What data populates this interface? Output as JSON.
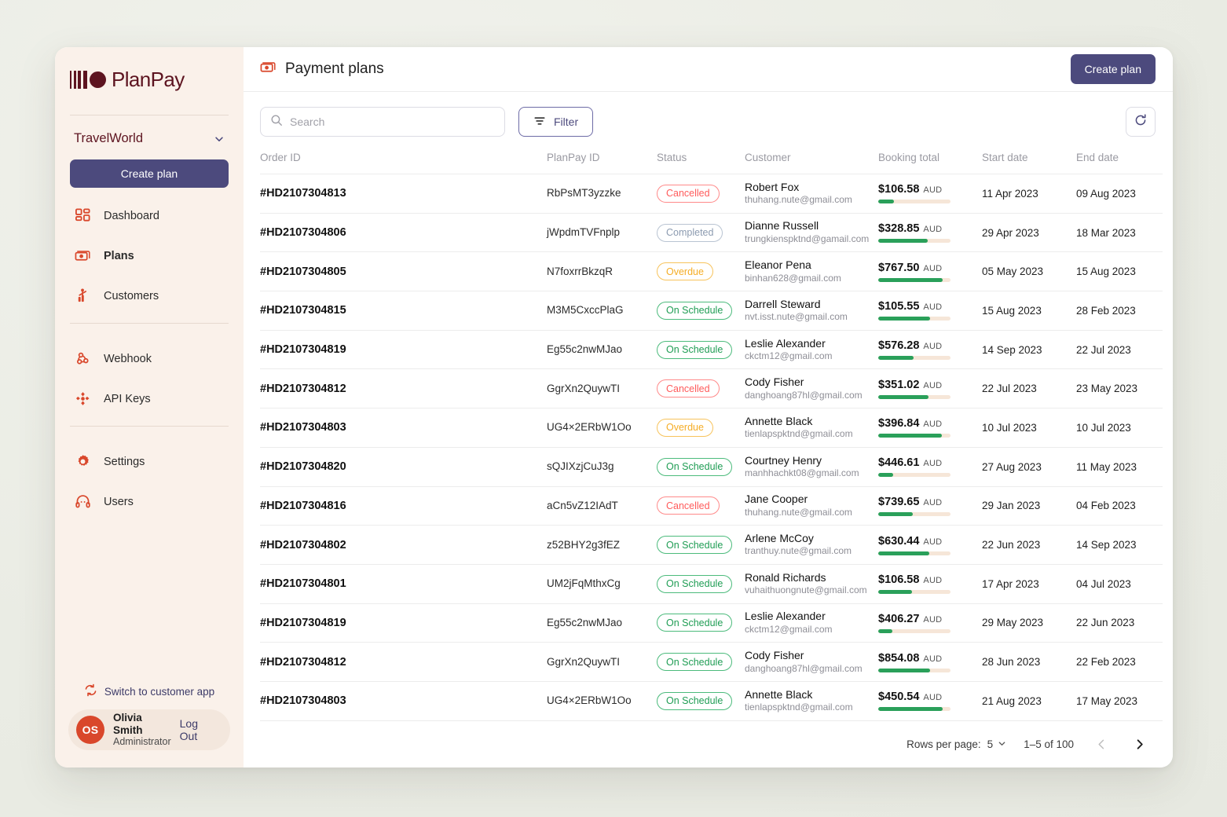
{
  "sidebar": {
    "logo_text": "PlanPay",
    "org_name": "TravelWorld",
    "create_plan_label": "Create plan",
    "nav_top": [
      {
        "label": "Dashboard",
        "icon": "grid-icon",
        "active": false
      },
      {
        "label": "Plans",
        "icon": "money-icon",
        "active": true
      },
      {
        "label": "Customers",
        "icon": "customers-icon",
        "active": false
      }
    ],
    "nav_mid": [
      {
        "label": "Webhook",
        "icon": "webhook-icon",
        "active": false
      },
      {
        "label": "API Keys",
        "icon": "api-keys-icon",
        "active": false
      }
    ],
    "nav_bottom": [
      {
        "label": "Settings",
        "icon": "gear-icon",
        "active": false
      },
      {
        "label": "Users",
        "icon": "headset-icon",
        "active": false
      }
    ],
    "switch_label": "Switch to customer app",
    "user": {
      "initials": "OS",
      "name": "Olivia Smith",
      "role": "Administrator",
      "logout_label": "Log Out"
    }
  },
  "header": {
    "title": "Payment plans",
    "title_icon": "money-icon",
    "create_plan_label": "Create plan"
  },
  "toolbar": {
    "search_placeholder": "Search",
    "search_value": "",
    "filter_label": "Filter",
    "refresh_icon": "refresh-icon"
  },
  "table": {
    "columns": [
      "Order ID",
      "PlanPay ID",
      "Status",
      "Customer",
      "Booking total",
      "Start date",
      "End date"
    ],
    "rows": [
      {
        "order_id": "#HD2107304813",
        "planpay_id": "RbPsMT3yzzke",
        "status": "Cancelled",
        "customer": "Robert Fox",
        "email": "thuhang.nute@gmail.com",
        "amount": "$106.58",
        "currency": "AUD",
        "progress": 22,
        "start_date": "11 Apr 2023",
        "end_date": "09 Aug 2023"
      },
      {
        "order_id": "#HD2107304806",
        "planpay_id": "jWpdmTVFnplp",
        "status": "Completed",
        "customer": "Dianne Russell",
        "email": "trungkienspktnd@gamail.com",
        "amount": "$328.85",
        "currency": "AUD",
        "progress": 68,
        "start_date": "29 Apr 2023",
        "end_date": "18 Mar 2023"
      },
      {
        "order_id": "#HD2107304805",
        "planpay_id": "N7foxrrBkzqR",
        "status": "Overdue",
        "customer": "Eleanor Pena",
        "email": "binhan628@gmail.com",
        "amount": "$767.50",
        "currency": "AUD",
        "progress": 89,
        "start_date": "05 May 2023",
        "end_date": "15 Aug 2023"
      },
      {
        "order_id": "#HD2107304815",
        "planpay_id": "M3M5CxccPlaG",
        "status": "On Schedule",
        "customer": "Darrell Steward",
        "email": "nvt.isst.nute@gmail.com",
        "amount": "$105.55",
        "currency": "AUD",
        "progress": 72,
        "start_date": "15 Aug 2023",
        "end_date": "28 Feb 2023"
      },
      {
        "order_id": "#HD2107304819",
        "planpay_id": "Eg55c2nwMJao",
        "status": "On Schedule",
        "customer": "Leslie Alexander",
        "email": "ckctm12@gmail.com",
        "amount": "$576.28",
        "currency": "AUD",
        "progress": 49,
        "start_date": "14 Sep 2023",
        "end_date": "22 Jul 2023"
      },
      {
        "order_id": "#HD2107304812",
        "planpay_id": "GgrXn2QuywTI",
        "status": "Cancelled",
        "customer": "Cody Fisher",
        "email": "danghoang87hl@gmail.com",
        "amount": "$351.02",
        "currency": "AUD",
        "progress": 70,
        "start_date": "22 Jul 2023",
        "end_date": "23 May 2023"
      },
      {
        "order_id": "#HD2107304803",
        "planpay_id": "UG4×2ERbW1Oo",
        "status": "Overdue",
        "customer": "Annette Black",
        "email": "tienlapspktnd@gmail.com",
        "amount": "$396.84",
        "currency": "AUD",
        "progress": 88,
        "start_date": "10 Jul 2023",
        "end_date": "10 Jul 2023"
      },
      {
        "order_id": "#HD2107304820",
        "planpay_id": "sQJIXzjCuJ3g",
        "status": "On Schedule",
        "customer": "Courtney Henry",
        "email": "manhhachkt08@gmail.com",
        "amount": "$446.61",
        "currency": "AUD",
        "progress": 21,
        "start_date": "27 Aug 2023",
        "end_date": "11 May 2023"
      },
      {
        "order_id": "#HD2107304816",
        "planpay_id": "aCn5vZ12IAdT",
        "status": "Cancelled",
        "customer": "Jane Cooper",
        "email": "thuhang.nute@gmail.com",
        "amount": "$739.65",
        "currency": "AUD",
        "progress": 48,
        "start_date": "29 Jan 2023",
        "end_date": "04 Feb 2023"
      },
      {
        "order_id": "#HD2107304802",
        "planpay_id": "z52BHY2g3fEZ",
        "status": "On Schedule",
        "customer": "Arlene McCoy",
        "email": "tranthuy.nute@gmail.com",
        "amount": "$630.44",
        "currency": "AUD",
        "progress": 71,
        "start_date": "22 Jun 2023",
        "end_date": "14 Sep 2023"
      },
      {
        "order_id": "#HD2107304801",
        "planpay_id": "UM2jFqMthxCg",
        "status": "On Schedule",
        "customer": "Ronald Richards",
        "email": "vuhaithuongnute@gmail.com",
        "amount": "$106.58",
        "currency": "AUD",
        "progress": 47,
        "start_date": "17 Apr 2023",
        "end_date": "04 Jul 2023"
      },
      {
        "order_id": "#HD2107304819",
        "planpay_id": "Eg55c2nwMJao",
        "status": "On Schedule",
        "customer": "Leslie Alexander",
        "email": "ckctm12@gmail.com",
        "amount": "$406.27",
        "currency": "AUD",
        "progress": 20,
        "start_date": "29 May 2023",
        "end_date": "22 Jun 2023"
      },
      {
        "order_id": "#HD2107304812",
        "planpay_id": "GgrXn2QuywTI",
        "status": "On Schedule",
        "customer": "Cody Fisher",
        "email": "danghoang87hl@gmail.com",
        "amount": "$854.08",
        "currency": "AUD",
        "progress": 72,
        "start_date": "28 Jun 2023",
        "end_date": "22 Feb 2023"
      },
      {
        "order_id": "#HD2107304803",
        "planpay_id": "UG4×2ERbW1Oo",
        "status": "On Schedule",
        "customer": "Annette Black",
        "email": "tienlapspktnd@gmail.com",
        "amount": "$450.54",
        "currency": "AUD",
        "progress": 89,
        "start_date": "21 Aug 2023",
        "end_date": "17 May 2023"
      }
    ]
  },
  "pagination": {
    "rows_per_page_label": "Rows per page:",
    "rows_per_page_value": "5",
    "range_label": "1–5 of 100",
    "prev_icon": "chevron-left-icon",
    "next_icon": "chevron-right-icon"
  },
  "colors": {
    "brand_maroon": "#5d1420",
    "accent_orange": "#d9472b",
    "primary_purple": "#4c4a7d",
    "sidebar_bg": "#faf1ea",
    "status_cancelled": "#ff5b5b",
    "status_completed": "#8c9bb0",
    "status_overdue": "#f5ad26",
    "status_onschedule": "#1f9d54",
    "progress_fill": "#2aa05a",
    "progress_track": "#f6e6d8"
  }
}
